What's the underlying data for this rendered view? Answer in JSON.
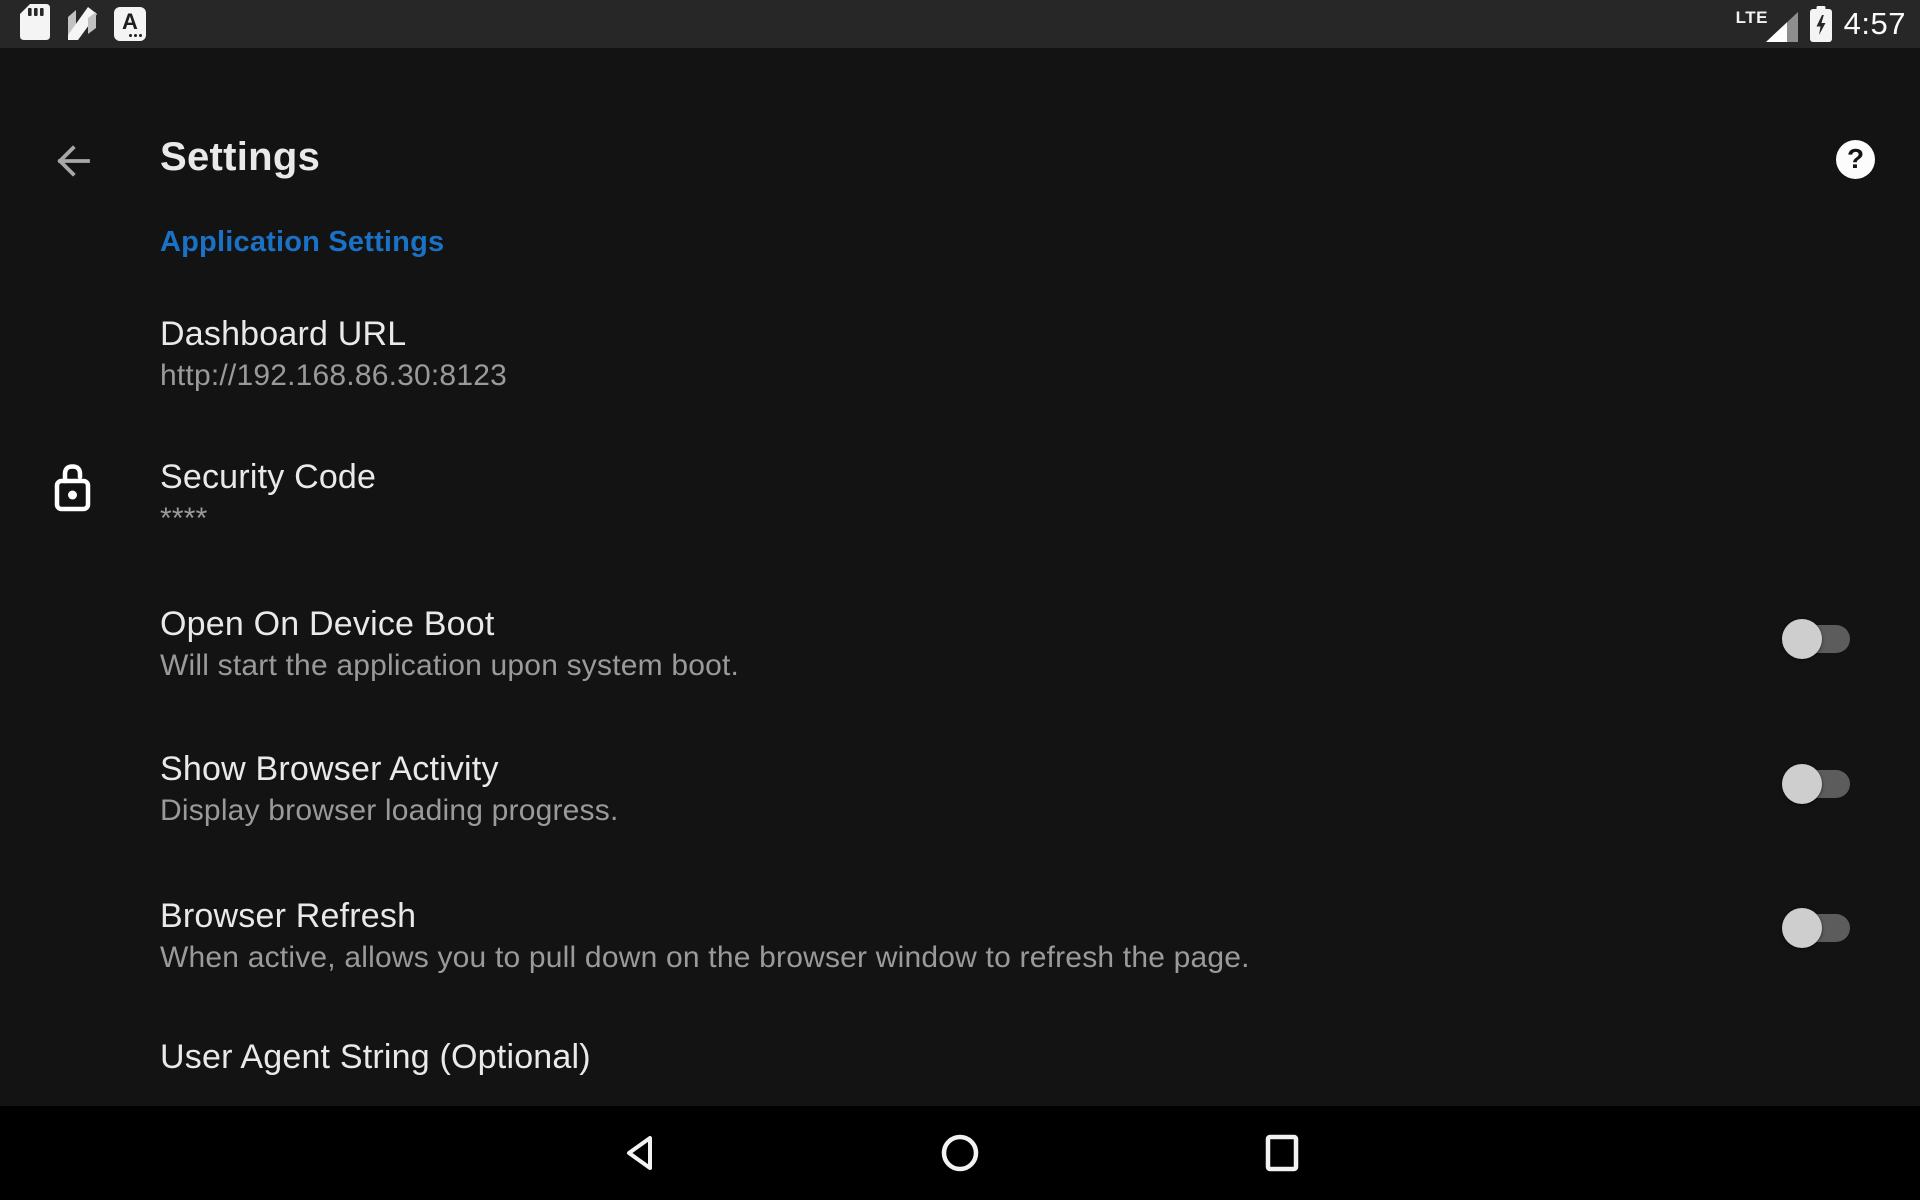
{
  "status_bar": {
    "time": "4:57",
    "network_label": "LTE",
    "a_app_glyph": "A",
    "left_icons": [
      "sdcard-icon",
      "android-nougat-icon",
      "a-app-icon"
    ],
    "right_icons": [
      "signal-triangle-icon",
      "battery-charging-icon"
    ]
  },
  "app_bar": {
    "title": "Settings",
    "help_glyph": "?"
  },
  "section_header": "Application Settings",
  "settings": [
    {
      "title": "Dashboard URL",
      "subtitle": "http://192.168.86.30:8123"
    },
    {
      "title": "Security Code",
      "subtitle": "****",
      "icon": "lock-open-icon"
    },
    {
      "title": "Open On Device Boot",
      "subtitle": "Will start the application upon system boot.",
      "toggle": "off"
    },
    {
      "title": "Show Browser Activity",
      "subtitle": "Display browser loading progress.",
      "toggle": "off"
    },
    {
      "title": "Browser Refresh",
      "subtitle": "When active, allows you to pull down on the browser window to refresh the page.",
      "toggle": "off"
    },
    {
      "title": "User Agent String (Optional)"
    }
  ],
  "nav_bar": {
    "buttons": [
      "back",
      "home",
      "recents"
    ]
  },
  "colors": {
    "status_bar_bg": "#272727",
    "content_bg": "#131313",
    "nav_bar_bg": "#000000",
    "accent_blue": "#1A72C6",
    "title_text": "#E9E9E9",
    "subtitle_text": "#9A9A9A",
    "toggle_track": "#5C5C5C",
    "toggle_thumb": "#CECECE"
  }
}
